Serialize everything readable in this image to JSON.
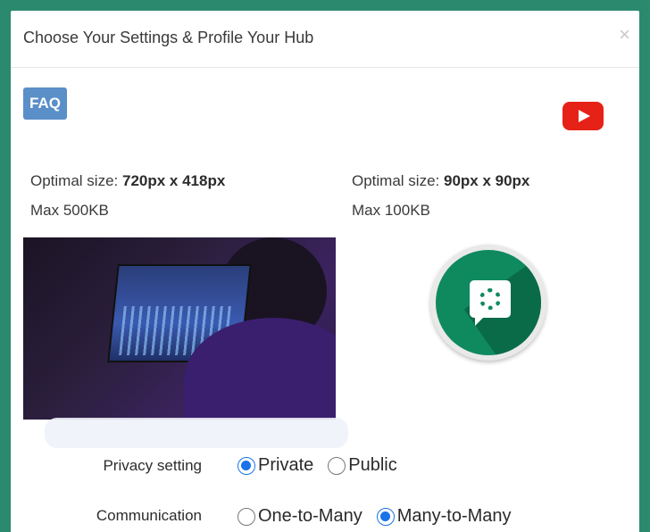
{
  "dialog": {
    "title": "Choose Your Settings & Profile Your Hub",
    "close_glyph": "×"
  },
  "toolbar": {
    "faq_label": "FAQ",
    "youtube_icon": "youtube-icon"
  },
  "cover_image": {
    "size_prefix": "Optimal size: ",
    "size_value": "720px x 418px",
    "max_size": "Max 500KB"
  },
  "logo_image": {
    "size_prefix": "Optimal size: ",
    "size_value": "90px x 90px",
    "max_size": "Max 100KB",
    "icon": "settings-chat-icon"
  },
  "privacy": {
    "label": "Privacy setting",
    "options": [
      "Private",
      "Public"
    ],
    "selected": "Private"
  },
  "communication": {
    "label": "Communication",
    "options": [
      "One-to-Many",
      "Many-to-Many"
    ],
    "selected": "Many-to-Many"
  },
  "colors": {
    "backdrop": "#2b8a6e",
    "faq_button": "#5a8fc8",
    "youtube_red": "#e62117",
    "radio_selected": "#1a73e8",
    "logo_green": "#0f8a5f"
  }
}
